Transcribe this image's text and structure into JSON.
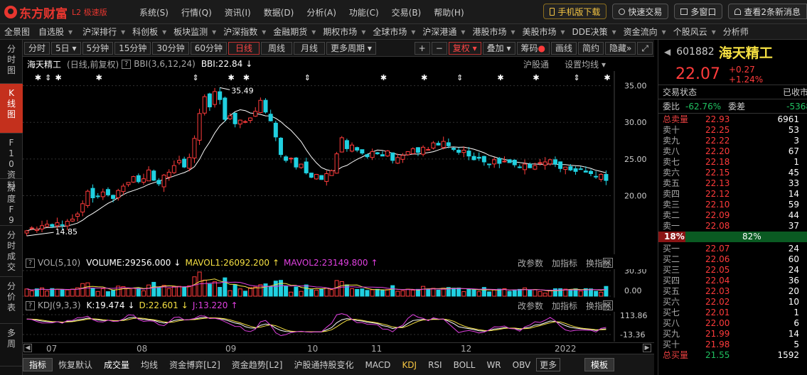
{
  "app": {
    "brand": "东方财富",
    "brand_sub": "L2 极速版"
  },
  "menu": [
    "系统(S)",
    "行情(Q)",
    "资讯(I)",
    "数据(D)",
    "分析(A)",
    "功能(C)",
    "交易(B)",
    "帮助(H)"
  ],
  "top_buttons": {
    "mobile": "手机版下载",
    "quick": "快速交易",
    "multi": "多窗口",
    "news": "查看2条新消息"
  },
  "nav": [
    "全景图",
    "自选股",
    "沪深排行",
    "科创板",
    "板块监测",
    "沪深指数",
    "金融期货",
    "期权市场",
    "全球市场",
    "沪深港通",
    "港股市场",
    "美股市场",
    "DDE决策",
    "资金流向",
    "个股风云",
    "分析师"
  ],
  "left_tabs": [
    "分时图",
    "K线图",
    "F10资料",
    "深度F9",
    "分时成交",
    "分价表",
    "多周"
  ],
  "periods": [
    "分时",
    "5日",
    "5分钟",
    "15分钟",
    "30分钟",
    "60分钟",
    "日线",
    "周线",
    "月线",
    "更多周期"
  ],
  "tools": [
    "+",
    "−",
    "复权",
    "叠加",
    "筹码",
    "画线",
    "简约",
    "隐藏"
  ],
  "chart_header": {
    "name": "海天精工",
    "mode": "(日线,前复权)",
    "bbi_params": "BBI(3,6,12,24)",
    "bbi_value": "BBI:22.84",
    "sgt": "沪股通",
    "set_ma": "设置均线"
  },
  "vol_header": {
    "label": "VOL(5,10)",
    "volume": "VOLUME:29256.000",
    "mavol1": "MAVOL1:26092.200",
    "mavol2": "MAVOL2:23149.800"
  },
  "kdj_header": {
    "label": "KDJ(9,3,3)",
    "k": "K:19.474",
    "d": "D:22.601",
    "j": "J:13.220"
  },
  "panel_actions": [
    "改参数",
    "加指标",
    "换指标"
  ],
  "price_axis": [
    "35.00",
    "30.00",
    "25.00",
    "20.00"
  ],
  "vol_axis": [
    "30.30",
    "0.00"
  ],
  "kdj_axis": [
    "113.86",
    "-13.36"
  ],
  "annotations": {
    "high": "35.49",
    "low": "14.85"
  },
  "x_months": [
    "07",
    "08",
    "09",
    "10",
    "11",
    "12",
    "2022"
  ],
  "bottom_tabs": [
    "指标",
    "恢复默认",
    "成交量",
    "均线",
    "资金博弈[L2]",
    "资金趋势[L2]",
    "沪股通持股变化",
    "MACD",
    "KDJ",
    "RSI",
    "BOLL",
    "WR",
    "OBV",
    "更多",
    "模板"
  ],
  "stock": {
    "code": "601882",
    "name": "海天精工",
    "price": "22.07",
    "change": "+0.27",
    "pct": "+1.24%",
    "status_label": "交易状态",
    "status": "已收市",
    "weibi_label": "委比",
    "weibi": "-62.76%",
    "weicha_label": "委差",
    "weicha": "-5368"
  },
  "sell_total": {
    "label": "总卖量",
    "price": "22.93",
    "vol": "6961"
  },
  "asks": [
    {
      "label": "卖十",
      "price": "22.25",
      "vol": "53"
    },
    {
      "label": "卖九",
      "price": "22.22",
      "vol": "3"
    },
    {
      "label": "卖八",
      "price": "22.20",
      "vol": "67"
    },
    {
      "label": "卖七",
      "price": "22.18",
      "vol": "1"
    },
    {
      "label": "卖六",
      "price": "22.15",
      "vol": "45"
    },
    {
      "label": "卖五",
      "price": "22.13",
      "vol": "33"
    },
    {
      "label": "卖四",
      "price": "22.12",
      "vol": "14"
    },
    {
      "label": "卖三",
      "price": "22.10",
      "vol": "59"
    },
    {
      "label": "卖二",
      "price": "22.09",
      "vol": "44"
    },
    {
      "label": "卖一",
      "price": "22.08",
      "vol": "37"
    }
  ],
  "ratio": {
    "left": "18%",
    "right": "82%",
    "fraction": 0.18
  },
  "bids": [
    {
      "label": "买一",
      "price": "22.07",
      "vol": "24"
    },
    {
      "label": "买二",
      "price": "22.06",
      "vol": "60"
    },
    {
      "label": "买三",
      "price": "22.05",
      "vol": "24"
    },
    {
      "label": "买四",
      "price": "22.04",
      "vol": "36"
    },
    {
      "label": "买五",
      "price": "22.03",
      "vol": "20"
    },
    {
      "label": "买六",
      "price": "22.02",
      "vol": "10"
    },
    {
      "label": "买七",
      "price": "22.01",
      "vol": "1"
    },
    {
      "label": "买八",
      "price": "22.00",
      "vol": "6"
    },
    {
      "label": "买九",
      "price": "21.99",
      "vol": "14"
    },
    {
      "label": "买十",
      "price": "21.98",
      "vol": "5"
    }
  ],
  "buy_total": {
    "label": "总买量",
    "price": "21.55",
    "vol": "1592"
  },
  "colors": {
    "up": "#ff3b3b",
    "down": "#20d0e0",
    "accent": "#c4301d"
  },
  "chart_data": {
    "type": "candlestick",
    "ylim": [
      12,
      37
    ],
    "closes": [
      15.2,
      15.6,
      15.4,
      15.9,
      16.1,
      15.8,
      16.3,
      16.0,
      16.5,
      16.8,
      17.5,
      18.9,
      20.6,
      19.7,
      19.9,
      20.5,
      20.1,
      19.6,
      20.7,
      21.3,
      21.8,
      22.6,
      21.9,
      22.3,
      23.5,
      22.1,
      21.6,
      22.8,
      23.2,
      24.1,
      24.8,
      23.9,
      25.2,
      27.8,
      31.2,
      33.5,
      32.1,
      34.2,
      33.1,
      30.4,
      30.9,
      29.8,
      30.3,
      30.1,
      30.6,
      31.5,
      33.0,
      31.4,
      30.2,
      28.0,
      25.6,
      24.8,
      25.1,
      23.9,
      24.3,
      23.1,
      22.5,
      22.9,
      22.2,
      23.0,
      23.4,
      25.7,
      27.9,
      26.4,
      26.9,
      26.2,
      25.8,
      25.3,
      26.0,
      25.7,
      25.4,
      26.1,
      24.8,
      25.2,
      25.5,
      26.0,
      26.4,
      25.9,
      26.6,
      26.3,
      27.2,
      26.9,
      27.4,
      26.8,
      26.3,
      25.9,
      26.2,
      25.4,
      24.9,
      25.1,
      24.6,
      24.3,
      24.9,
      24.4,
      24.7,
      24.5,
      24.2,
      23.9,
      24.3,
      23.8,
      24.1,
      24.5,
      24.6,
      24.9,
      24.3,
      23.7,
      23.9,
      23.5,
      23.3,
      23.6,
      23.2,
      23.0,
      22.6,
      22.9,
      22.07
    ]
  }
}
